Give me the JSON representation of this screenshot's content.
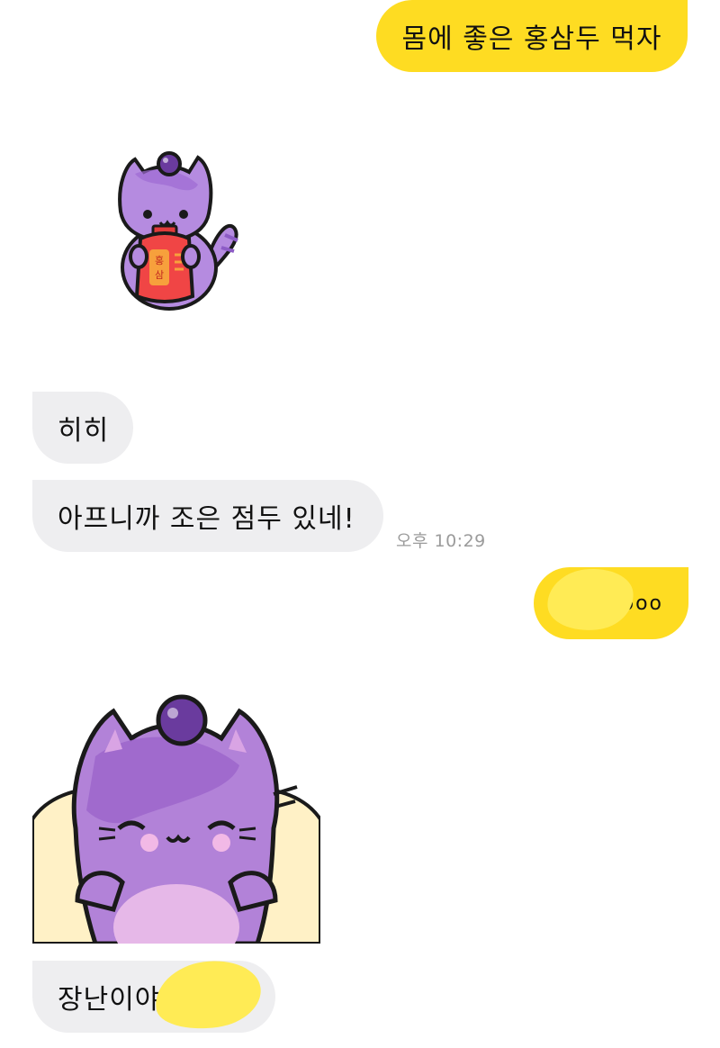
{
  "messages": [
    {
      "sender": "me",
      "type": "text",
      "text": "몸에 좋은 홍삼두 먹자"
    },
    {
      "sender": "other",
      "type": "sticker",
      "sticker": "purple-cat-holding-red-ginseng-bottle-icon",
      "label": "홍삼"
    },
    {
      "sender": "other",
      "type": "text",
      "text": "히히"
    },
    {
      "sender": "other",
      "type": "text",
      "text": "아프니까 조은 점두 있네!",
      "time": "오후 10:29"
    },
    {
      "sender": "me",
      "type": "text",
      "text": "oooo",
      "redacted": true
    },
    {
      "sender": "other",
      "type": "sticker",
      "sticker": "purple-cat-smiling-icon"
    },
    {
      "sender": "other",
      "type": "text",
      "text": "장난이야",
      "redacted": true
    }
  ],
  "colors": {
    "my_bubble": "#FEDC22",
    "their_bubble": "#EEEEF0",
    "timestamp": "#9b9b9b",
    "redaction": "#FFEB55"
  }
}
